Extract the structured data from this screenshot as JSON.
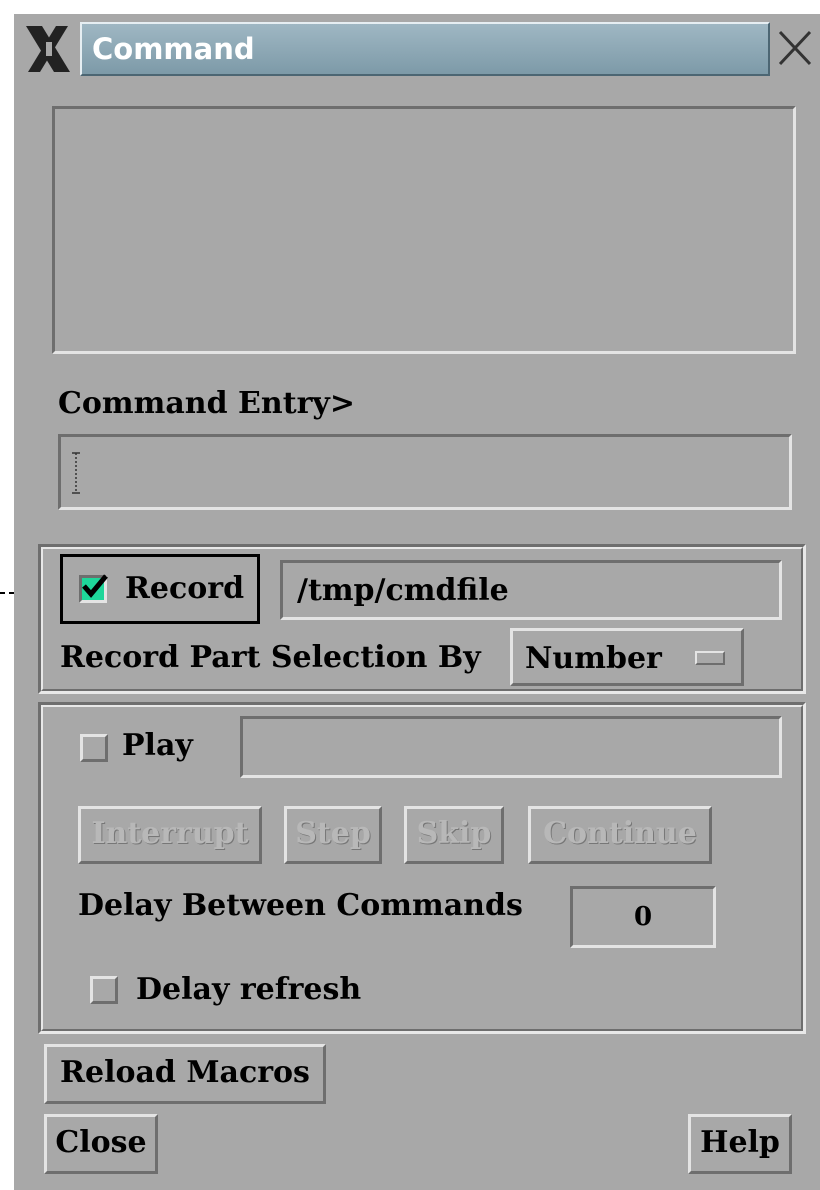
{
  "window": {
    "title": "Command",
    "close_icon": "close-icon",
    "menu_icon": "x-window-icon"
  },
  "output_area": {
    "value": ""
  },
  "command_entry": {
    "label": "Command Entry>",
    "value": ""
  },
  "record": {
    "checkbox_label": "Record",
    "checked": true,
    "check_color": "#1fd69a",
    "file_path": "/tmp/cmdfile",
    "part_selection_label": "Record Part Selection By",
    "part_selection_value": "Number"
  },
  "play": {
    "checkbox_label": "Play",
    "checked": false,
    "file_value": "",
    "buttons": {
      "interrupt": "Interrupt",
      "step": "Step",
      "skip": "Skip",
      "continue": "Continue"
    },
    "delay_label": "Delay Between Commands",
    "delay_value": "0",
    "delay_refresh_label": "Delay refresh"
  },
  "footer": {
    "reload_macros": "Reload Macros",
    "close": "Close",
    "help": "Help"
  }
}
